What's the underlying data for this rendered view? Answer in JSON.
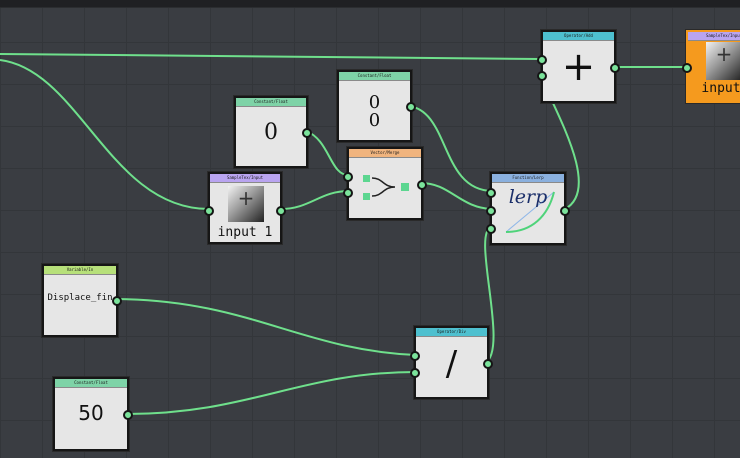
{
  "canvas": {
    "wire_color": "#6fe08c",
    "background": "#3a3d42"
  },
  "nodes": {
    "const_zero": {
      "header": "Constant/Float",
      "value": "0"
    },
    "const_vec": {
      "header": "Constant/Float",
      "value_x": "0",
      "value_y": "0"
    },
    "input1": {
      "header": "SampleTex/Input",
      "label": "input 1",
      "icon": "texture-preview"
    },
    "merge": {
      "header": "Vector/Merge",
      "icon": "merge-icon"
    },
    "add": {
      "header": "Operator/Add",
      "symbol": "+"
    },
    "lerp": {
      "header": "Function/Lerp",
      "symbol": "lerp"
    },
    "output": {
      "header": "SampleTex/Input",
      "label": "input",
      "accent": "#f59a1e"
    },
    "variable": {
      "header": "Variable/In",
      "label": "Displace_fin"
    },
    "divide": {
      "header": "Operator/Div",
      "symbol": "/"
    },
    "const_50": {
      "header": "Constant/Float",
      "value": "50"
    }
  }
}
